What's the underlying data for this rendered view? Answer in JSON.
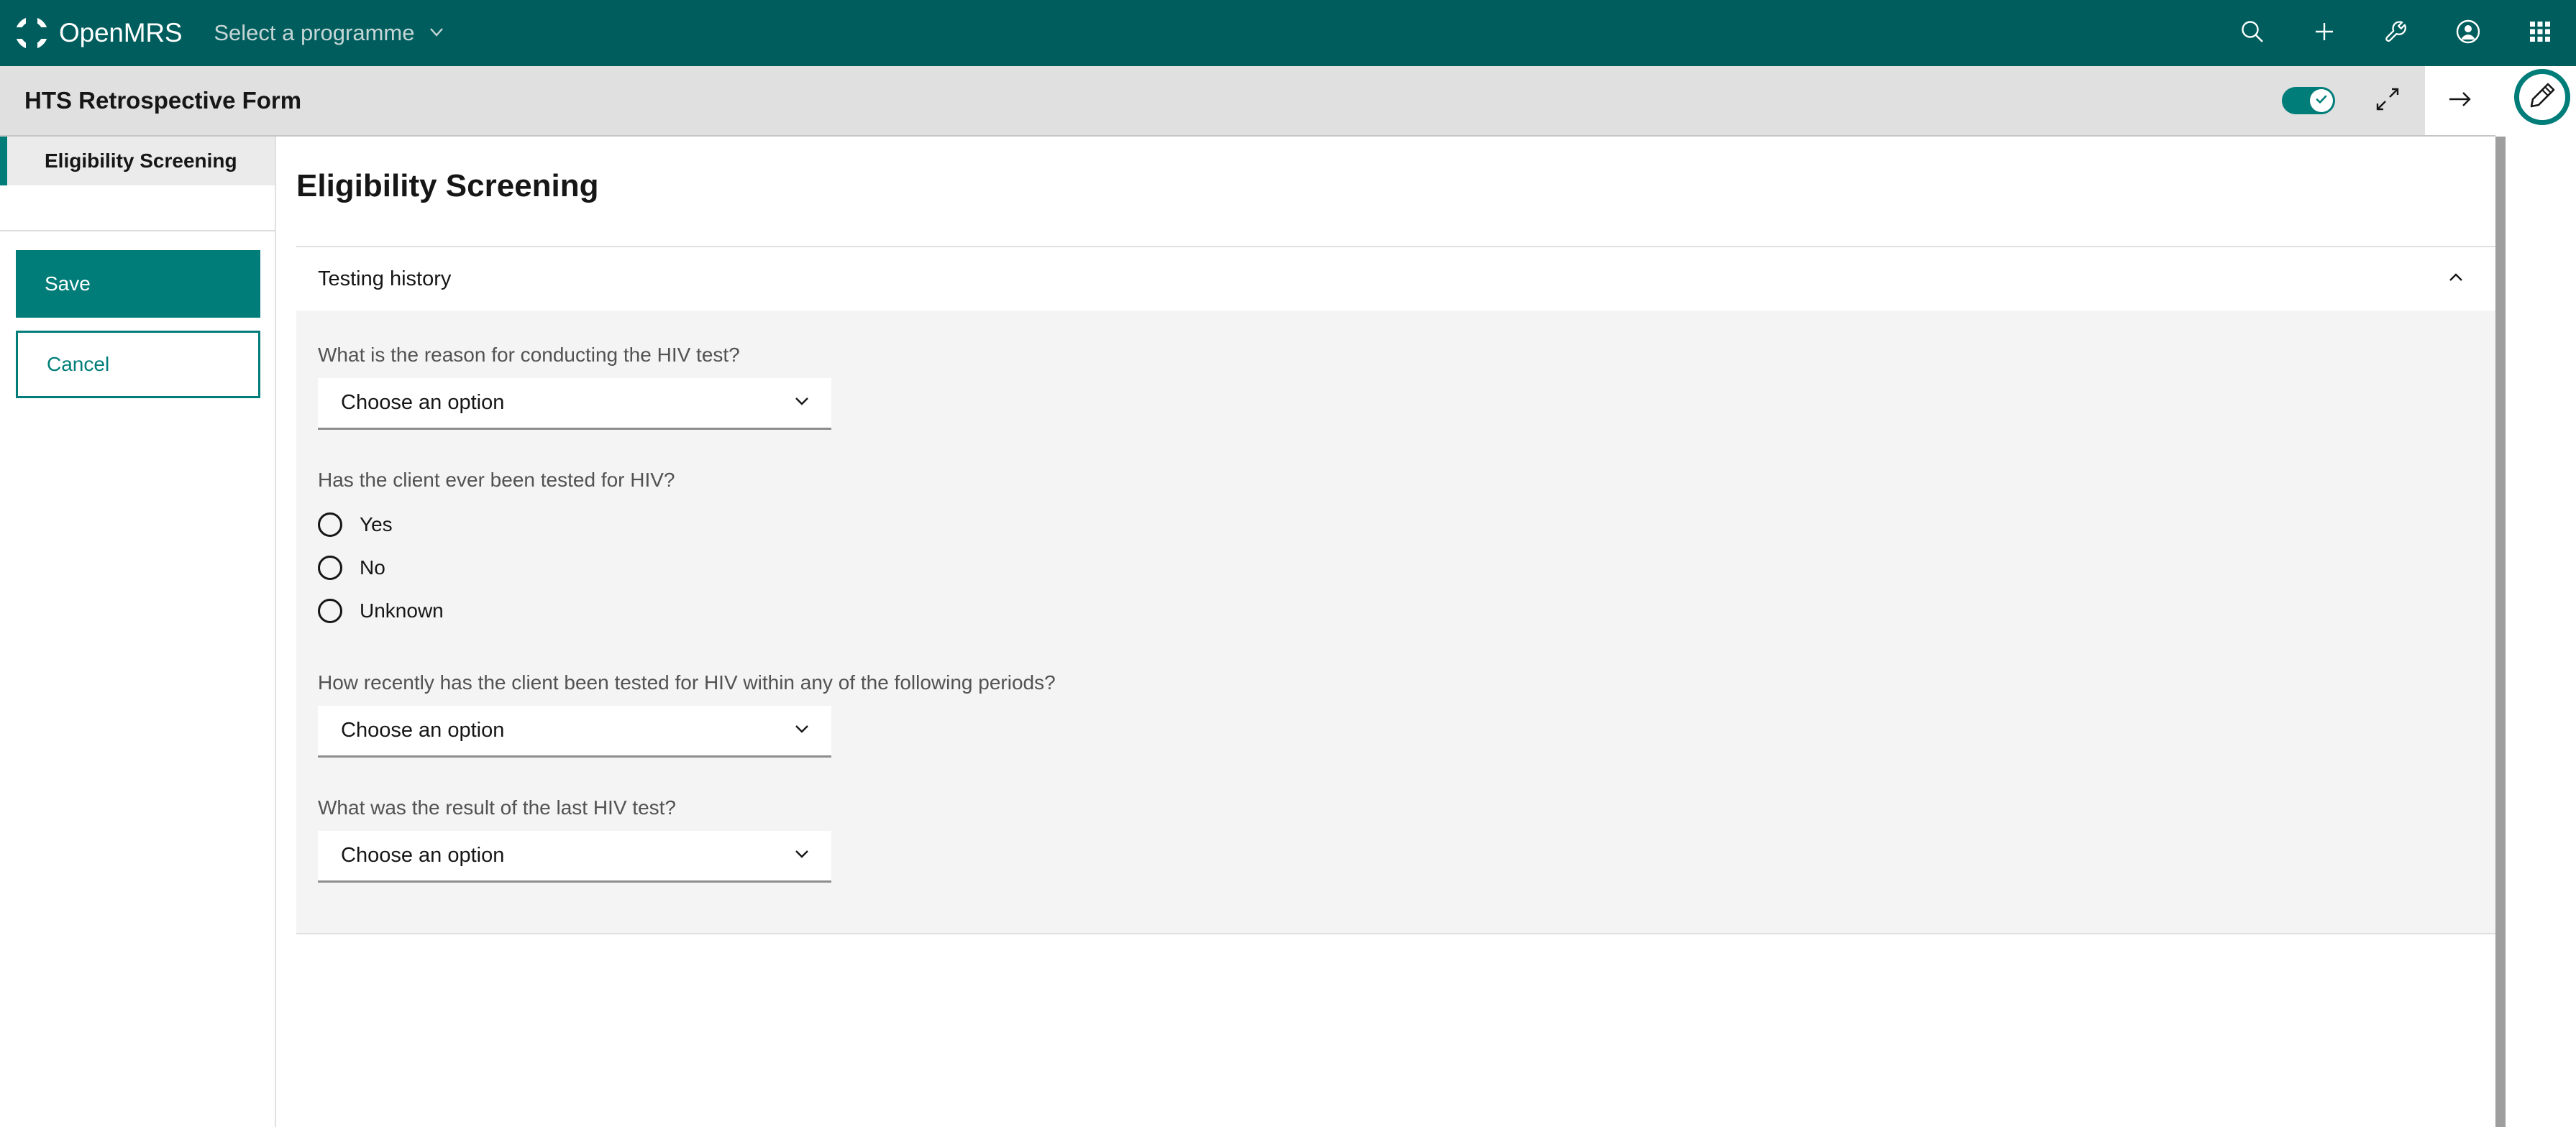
{
  "colors": {
    "brand_teal_dark": "#005d5d",
    "brand_teal": "#007d79",
    "header_bar_gray": "#e0e0e0",
    "field_bg_gray": "#f4f4f4",
    "text_primary": "#161616",
    "text_secondary": "#525252"
  },
  "topnav": {
    "brand_name": "OpenMRS",
    "logo_icon": "openmrs-logo-icon",
    "programme_selector": {
      "label": "Select a programme",
      "chevron_icon": "chevron-down-icon"
    },
    "actions": [
      {
        "icon": "search-icon",
        "name": "search-button"
      },
      {
        "icon": "plus-icon",
        "name": "add-button"
      },
      {
        "icon": "wrench-icon",
        "name": "tools-button"
      },
      {
        "icon": "user-avatar-icon",
        "name": "user-button"
      },
      {
        "icon": "app-grid-icon",
        "name": "app-switcher-button"
      }
    ]
  },
  "formbar": {
    "title": "HTS Retrospective Form",
    "toggle": {
      "name": "form-mode-toggle",
      "state": "on",
      "knob_icon": "checkmark-icon"
    },
    "collapse_icon": "collapse-arrows-icon",
    "next_icon": "arrow-right-icon"
  },
  "edit_fab": {
    "icon": "pencil-edit-icon",
    "name": "edit-form-button"
  },
  "sidebar": {
    "items": [
      {
        "label": "Eligibility Screening",
        "active": true
      }
    ],
    "save_label": "Save",
    "cancel_label": "Cancel"
  },
  "main": {
    "page_title": "Eligibility Screening",
    "accordion": {
      "title": "Testing history",
      "expanded": true,
      "chevron_icon": "chevron-up-icon"
    },
    "fields": [
      {
        "type": "select",
        "label": "What is the reason for conducting the HIV test?",
        "value": "Choose an option",
        "chevron_icon": "chevron-down-icon"
      },
      {
        "type": "radio",
        "label": "Has the client ever been tested for HIV?",
        "options": [
          {
            "label": "Yes",
            "selected": false
          },
          {
            "label": "No",
            "selected": false
          },
          {
            "label": "Unknown",
            "selected": false
          }
        ]
      },
      {
        "type": "select",
        "label": "How recently has the client been tested for HIV within any of the following periods?",
        "value": "Choose an option",
        "chevron_icon": "chevron-down-icon"
      },
      {
        "type": "select",
        "label": "What was the result of the last HIV test?",
        "value": "Choose an option",
        "chevron_icon": "chevron-down-icon"
      }
    ]
  }
}
